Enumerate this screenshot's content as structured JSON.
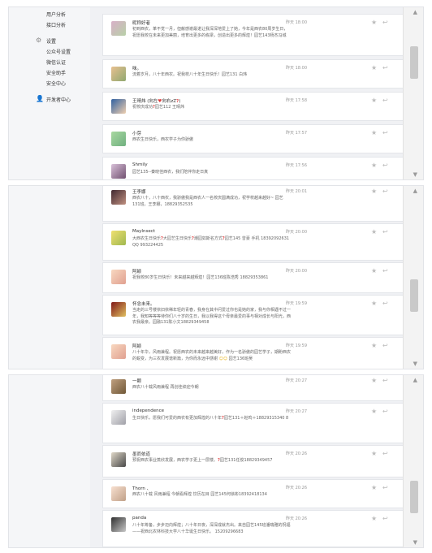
{
  "sidebar": {
    "items_top": [
      "用户分析",
      "接口分析"
    ],
    "settings_label": "设置",
    "settings_items": [
      "公众号设置",
      "微信认证",
      "安全助手",
      "安全中心"
    ],
    "developer_label": "开发者中心"
  },
  "panel1": {
    "messages": [
      {
        "name": "昵称好者",
        "time": "昨天 18:00",
        "text": "初到西农，革不觉一月，但献感谢最诺让我深深地爱上了她，今年是西农80周岁生日，祝愿我校在未来更加美丽，培育出更多的栋梁，创造出更多的辉煌！园艺143杨杰冯城"
      },
      {
        "name": "咪。",
        "time": "昨天 18:00",
        "text": "流着岁月，八十年西农。祝我校八十年生日快乐！园艺131 白玮"
      },
      {
        "name_pre": "王晴炜 (向左",
        "name_mid": "向右zZ",
        "name_q": "?",
        "name_post": ")",
        "time": "昨天 17:58",
        "text_pre": "祝校庆成功",
        "text_post": "园艺112 王晴炜"
      },
      {
        "name": "小芽",
        "time": "昨天 17:57",
        "text": "西农生日快乐，西农学子为你骄傲"
      },
      {
        "name": "Shmily",
        "time": "昨天 17:56",
        "text": "园艺135--秦晓佳西农，我们陪伴你走日真"
      }
    ]
  },
  "panel2": {
    "messages": [
      {
        "name": "王李娜",
        "time": "昨天 20:01",
        "text": "西农八十，八十西农，我骄傲我是西农人一名校庆圆满成功，祝学校越来越好~ 园艺131班，王李娜，18829352535"
      },
      {
        "name": "MayInsect",
        "time": "昨天 20:00",
        "text_pre": "大西农生日快乐",
        "text_mid": "大园艺生日快乐",
        "text_mid2": "潮园如斯名方式",
        "text_post": "园艺145 曾豪 手机 18392092631 QQ 993224425"
      },
      {
        "name": "阿颖",
        "time": "昨天 20:00",
        "text": "祝我校80岁生日快乐！未来越来越辉煌！园艺136班陈浩秀 18829353861"
      },
      {
        "name": "怀念未来。",
        "time": "昨天 19:59",
        "text": "当走的三号楼依旧依稀年轻的青春，我身在其中问爱过你也是她的家，我与你相遇不过一年，我知等等等待你们八十岁的生日，我以我得这个母亲最爱的事与相对成长与阳光，西农我最亲。园融131陈小文18829349458"
      },
      {
        "name": "阿颖",
        "time": "昨天 19:59",
        "text_pre": "八十年华，风雨兼程。祝愿西农的未来越来越美好，作为一名骄傲的园艺学子，期盼西农的蜕变，为三农发展谱新篇，为你而永远中感谢",
        "text_post": "园艺136班吴"
      }
    ]
  },
  "panel3": {
    "messages": [
      {
        "name": "一颗",
        "time": "昨天 20:27",
        "text": "西农八十载风雨兼程 再创佳绩迎今朝"
      },
      {
        "name": "independence",
        "time": "昨天 20:27",
        "text_pre": "生日快乐，愿我们可爱的西农有更加辉煌的八十年",
        "text_post": "园艺131＋赵鸣＋18829315340 8"
      },
      {
        "name": "墨而依道",
        "time": "昨天 20:26",
        "text_pre": "预祝西农事业蒸欣发展，西农学子更上一层楼。",
        "text_post": "园艺131任俊18829349457"
      },
      {
        "name": "Thorn 、",
        "time": "昨天 20:26",
        "text": "西农八十载 风雨兼程 今朝看辉煌 饮历在目 园艺145何徐彬18392418134"
      },
      {
        "name": "panda",
        "time": "昨天 20:26",
        "text": "八十年筹备，步步迈向辉煌；八十年日夜，深深成就杰出。来自园艺145班潘瑞雅的祝福——祝西北农林科技大学八十华诞生日快乐。 15209296683"
      }
    ]
  },
  "colors": {
    "question_mark": "#e04646",
    "accent": "#4a90d9"
  }
}
